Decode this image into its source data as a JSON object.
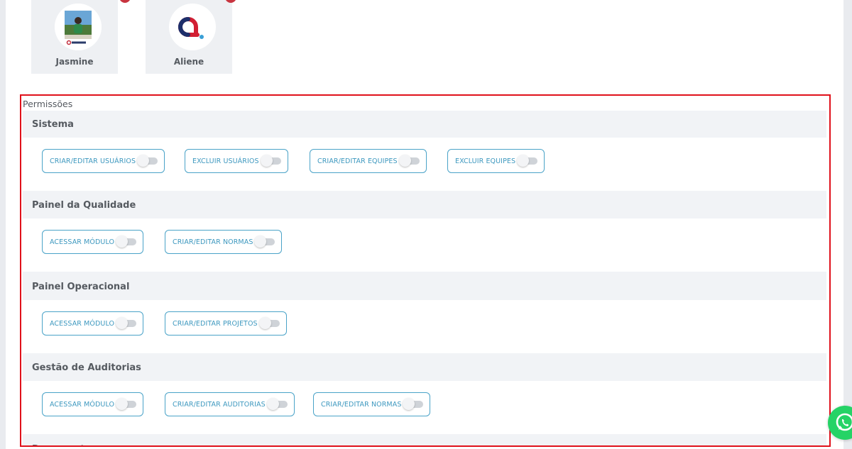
{
  "team": {
    "members": [
      {
        "name": "Jasmine"
      },
      {
        "name": "Aliene"
      }
    ]
  },
  "permissions": {
    "title": "Permissões",
    "sections": [
      {
        "title": "Sistema",
        "items": [
          {
            "label": "CRIAR/EDITAR USUÁRIOS",
            "enabled": false
          },
          {
            "label": "EXCLUIR USUÁRIOS",
            "enabled": false
          },
          {
            "label": "CRIAR/EDITAR EQUIPES",
            "enabled": false
          },
          {
            "label": "EXCLUIR EQUIPES",
            "enabled": false
          }
        ]
      },
      {
        "title": "Painel da Qualidade",
        "items": [
          {
            "label": "ACESSAR MÓDULO",
            "enabled": false
          },
          {
            "label": "CRIAR/EDITAR NORMAS",
            "enabled": false
          }
        ]
      },
      {
        "title": "Painel Operacional",
        "items": [
          {
            "label": "ACESSAR MÓDULO",
            "enabled": false
          },
          {
            "label": "CRIAR/EDITAR PROJETOS",
            "enabled": false
          }
        ]
      },
      {
        "title": "Gestão de Auditorias",
        "items": [
          {
            "label": "ACESSAR MÓDULO",
            "enabled": false
          },
          {
            "label": "CRIAR/EDITAR AUDITORIAS",
            "enabled": false
          },
          {
            "label": "CRIAR/EDITAR NORMAS",
            "enabled": false
          }
        ]
      },
      {
        "title": "Documentos",
        "items": []
      }
    ]
  },
  "colors": {
    "accent": "#3d98bf",
    "frame_highlight": "#e0111b",
    "badge": "#c8343f",
    "whatsapp": "#25d366"
  }
}
